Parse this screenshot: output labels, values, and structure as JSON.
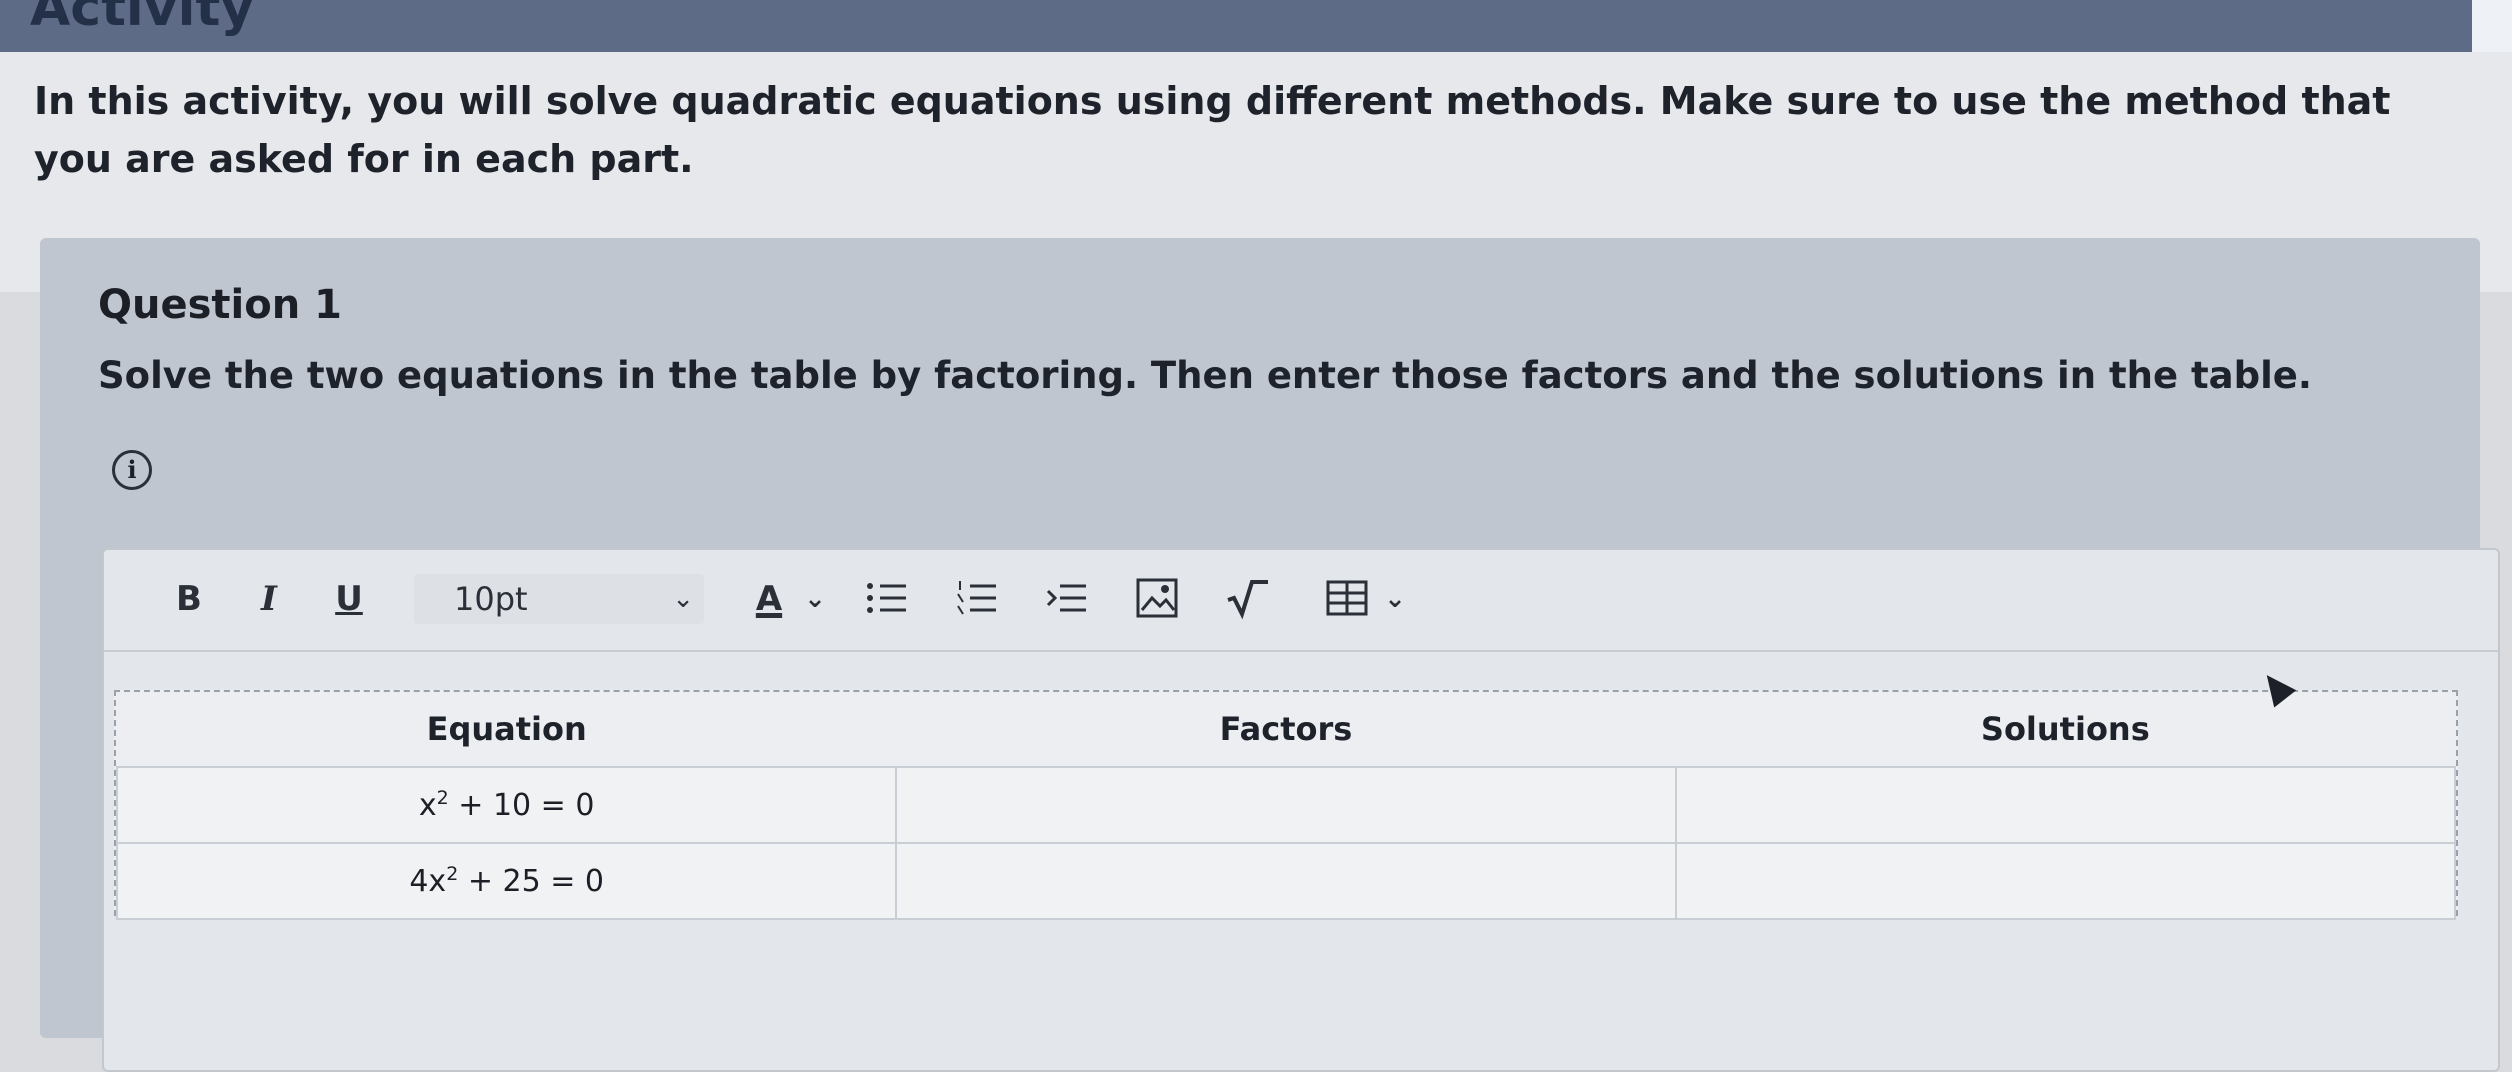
{
  "banner": {
    "title": "Activity"
  },
  "intro": {
    "text": "In this activity, you will solve quadratic equations using different methods. Make sure to use the method that you are asked for in each part."
  },
  "question": {
    "title": "Question 1",
    "prompt": "Solve the two equations in the table by factoring. Then enter those factors and the solutions in the table."
  },
  "toolbar": {
    "bold": "B",
    "italic": "I",
    "underline": "U",
    "font_size": "10pt",
    "font_color": "A"
  },
  "table": {
    "headers": [
      "Equation",
      "Factors",
      "Solutions"
    ],
    "rows": [
      {
        "base": "x",
        "exp": "2",
        "rest": " + 10 = 0",
        "factors": "",
        "solutions": ""
      },
      {
        "base": "4x",
        "exp": "2",
        "rest": " + 25 = 0",
        "factors": "",
        "solutions": ""
      }
    ]
  }
}
